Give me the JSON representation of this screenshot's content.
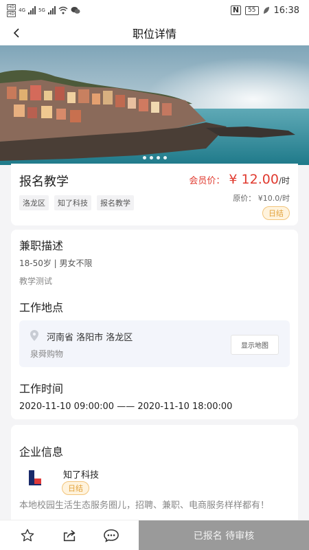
{
  "status_bar": {
    "sim1": "HD",
    "sim2": "HD",
    "net1": "4G",
    "net2": "5G",
    "battery": "55",
    "time": "16:38"
  },
  "nav": {
    "title": "职位详情"
  },
  "banner": {
    "slide_count": 4
  },
  "job": {
    "title": "报名教学",
    "tags": [
      "洛龙区",
      "知了科技",
      "报名教学"
    ],
    "member_price_label": "会员价：",
    "member_price_amount": "¥ 12.00",
    "member_price_unit": "/时",
    "original_price": "原价：  ¥10.0/时",
    "settle_badge": "日结"
  },
  "detail": {
    "desc_title": "兼职描述",
    "requirements": "18-50岁 | 男女不限",
    "desc_text": "教学测试",
    "location_title": "工作地点",
    "address": "河南省 洛阳市 洛龙区",
    "place": "泉舜购物",
    "map_button": "显示地图",
    "time_title": "工作时间",
    "time_range": "2020-11-10 09:00:00 —— 2020-11-10 18:00:00"
  },
  "company": {
    "section_title": "企业信息",
    "name": "知了科技",
    "badge": "日结",
    "description": "本地校园生活生态服务圈儿，招聘、兼职、电商服务样样都有！"
  },
  "bottom_bar": {
    "signup_label": "已报名 待审核"
  }
}
